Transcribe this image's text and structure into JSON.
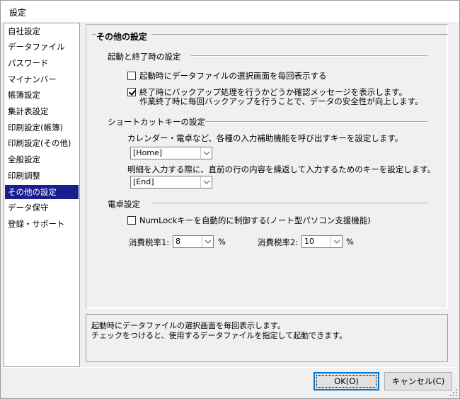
{
  "window": {
    "title": "設定"
  },
  "nav": {
    "items": [
      {
        "label": "自社設定"
      },
      {
        "label": "データファイル"
      },
      {
        "label": "パスワード"
      },
      {
        "label": "マイナンバー"
      },
      {
        "label": "帳簿設定"
      },
      {
        "label": "集計表設定"
      },
      {
        "label": "印刷設定(帳簿)"
      },
      {
        "label": "印刷設定(その他)"
      },
      {
        "label": "全般設定"
      },
      {
        "label": "印刷調整"
      },
      {
        "label": "その他の設定",
        "selected": true
      },
      {
        "label": "データ保守"
      },
      {
        "label": "登録・サポート"
      }
    ]
  },
  "main": {
    "section_title": "その他の設定",
    "startup": {
      "heading": "起動と終了時の設定",
      "show_file_select": {
        "label": "起動時にデータファイルの選択画面を毎回表示する",
        "checked": false
      },
      "backup_confirm": {
        "label": "終了時にバックアップ処理を行うかどうか確認メッセージを表示します。",
        "label_line2": "作業終了時に毎回バックアップを行うことで、データの安全性が向上します。",
        "checked": true
      }
    },
    "shortcut": {
      "heading": "ショートカットキーの設定",
      "desc1": "カレンダー・電卓など、各種の入力補助機能を呼び出すキーを設定します。",
      "key1": "[Home]",
      "desc2": "明細を入力する際に、直前の行の内容を繰返して入力するためのキーを設定します。",
      "key2": "[End]"
    },
    "calculator": {
      "heading": "電卓設定",
      "numlock": {
        "label": "NumLockキーを自動的に制御する(ノート型パソコン支援機能)",
        "checked": false
      },
      "tax1_label": "消費税率1:",
      "tax1_value": "8",
      "tax1_unit": "%",
      "tax2_label": "消費税率2:",
      "tax2_value": "10",
      "tax2_unit": "%"
    }
  },
  "help": {
    "line1": "起動時にデータファイルの選択画面を毎回表示します。",
    "line2": "チェックをつけると、使用するデータファイルを指定して起動できます。"
  },
  "buttons": {
    "ok": "OK(O)",
    "cancel": "キャンセル(C)"
  },
  "colors": {
    "selection": "#1a1f8e",
    "dialog_bg": "#f0f0f0",
    "default_button_border": "#0078d7"
  }
}
